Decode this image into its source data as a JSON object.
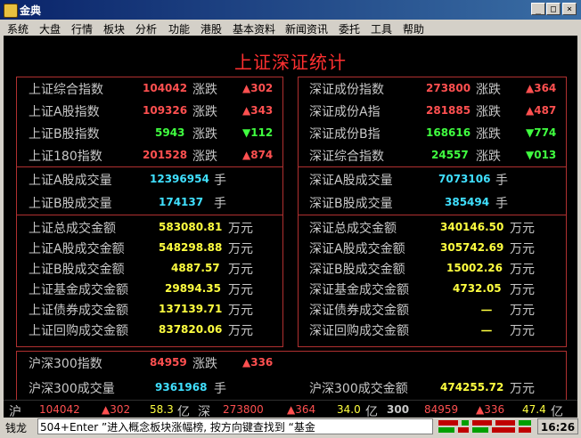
{
  "window": {
    "title": "金典",
    "min_glyph": "_",
    "max_glyph": "□",
    "close_glyph": "×"
  },
  "menu": [
    "系统",
    "大盘",
    "行情",
    "板块",
    "分析",
    "功能",
    "港股",
    "基本资料",
    "新闻资讯",
    "委托",
    "工具",
    "帮助"
  ],
  "page_title": "上证深证统计",
  "sh_index": [
    {
      "name": "上证综合指数",
      "value": "104042",
      "change_label": "涨跌",
      "change": "▲302",
      "dir": "up"
    },
    {
      "name": "上证A股指数",
      "value": "109326",
      "change_label": "涨跌",
      "change": "▲343",
      "dir": "up"
    },
    {
      "name": "上证B股指数",
      "value": "5943",
      "change_label": "涨跌",
      "change": "▼112",
      "dir": "down"
    },
    {
      "name": "上证180指数",
      "value": "201528",
      "change_label": "涨跌",
      "change": "▲874",
      "dir": "up"
    }
  ],
  "sz_index": [
    {
      "name": "深证成份指数",
      "value": "273800",
      "change_label": "涨跌",
      "change": "▲364",
      "dir": "up"
    },
    {
      "name": "深证成份A指",
      "value": "281885",
      "change_label": "涨跌",
      "change": "▲487",
      "dir": "up"
    },
    {
      "name": "深证成份B指",
      "value": "168616",
      "change_label": "涨跌",
      "change": "▼774",
      "dir": "down"
    },
    {
      "name": "深证综合指数",
      "value": "24557",
      "change_label": "涨跌",
      "change": "▼013",
      "dir": "down"
    }
  ],
  "sh_volume": [
    {
      "name": "上证A股成交量",
      "value": "12396954",
      "unit": "手"
    },
    {
      "name": "上证B股成交量",
      "value": "174137",
      "unit": "手"
    }
  ],
  "sz_volume": [
    {
      "name": "深证A股成交量",
      "value": "7073106",
      "unit": "手"
    },
    {
      "name": "深证B股成交量",
      "value": "385494",
      "unit": "手"
    }
  ],
  "sh_amount": [
    {
      "name": "上证总成交金额",
      "value": "583080.81",
      "unit": "万元"
    },
    {
      "name": "上证A股成交金额",
      "value": "548298.88",
      "unit": "万元"
    },
    {
      "name": "上证B股成交金额",
      "value": "4887.57",
      "unit": "万元"
    },
    {
      "name": "上证基金成交金额",
      "value": "29894.35",
      "unit": "万元"
    },
    {
      "name": "上证债券成交金额",
      "value": "137139.71",
      "unit": "万元"
    },
    {
      "name": "上证回购成交金额",
      "value": "837820.06",
      "unit": "万元"
    }
  ],
  "sz_amount": [
    {
      "name": "深证总成交金额",
      "value": "340146.50",
      "unit": "万元"
    },
    {
      "name": "深证A股成交金额",
      "value": "305742.69",
      "unit": "万元"
    },
    {
      "name": "深证B股成交金额",
      "value": "15002.26",
      "unit": "万元"
    },
    {
      "name": "深证基金成交金额",
      "value": "4732.05",
      "unit": "万元"
    },
    {
      "name": "深证债券成交金额",
      "value": "一",
      "unit": "万元"
    },
    {
      "name": "深证回购成交金额",
      "value": "一",
      "unit": "万元"
    }
  ],
  "hs300": {
    "index_name": "沪深300指数",
    "index_value": "84959",
    "change_label": "涨跌",
    "change": "▲336",
    "volume_name": "沪深300成交量",
    "volume_value": "9361968",
    "volume_unit": "手",
    "amount_name": "沪深300成交金额",
    "amount_value": "474255.72",
    "amount_unit": "万元"
  },
  "status": {
    "sh_label": "沪",
    "sh_value": "104042",
    "sh_change": "▲302",
    "sh_amount": "58.3",
    "sh_unit": "亿",
    "sz_label": "深",
    "sz_value": "273800",
    "sz_change": "▲364",
    "sz_amount": "34.0",
    "sz_unit": "亿",
    "hs_label": "300",
    "hs_value": "84959",
    "hs_change": "▲336",
    "hs_amount": "47.4",
    "hs_unit": "亿"
  },
  "bottom": {
    "label": "钱龙",
    "ticker": "504+Enter ”进入概念板块涨幅榜, 按方向键查找到 “基金",
    "clock": "16:26"
  },
  "colors": {
    "up": "#ff5050",
    "down": "#40ff40",
    "border": "#b03030"
  }
}
